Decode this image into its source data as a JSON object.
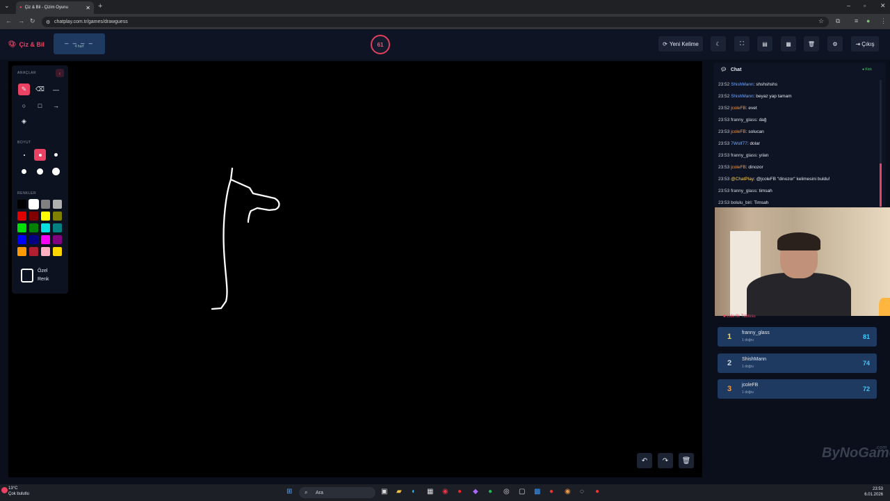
{
  "browser": {
    "tab_title": "Çiz & Bil - Çizim Oyunu",
    "url": "chatplay.com.tr/games/drawguess"
  },
  "header": {
    "logo": "Çiz & Bil",
    "word_mask": "_ _ _ _",
    "word_hint": "4 harf",
    "timer": "61",
    "new_word_label": "Yeni Kelime",
    "exit_label": "Çıkış"
  },
  "tools": {
    "tools_label": "ARAÇLAR",
    "size_label": "BOYUT",
    "colors_label": "RENKLER",
    "custom_color_label": "Özel Renk",
    "colors": [
      "#000000",
      "#ffffff",
      "#808080",
      "#b0b0b0",
      "#e00000",
      "#800000",
      "#ffff00",
      "#808000",
      "#00e000",
      "#008000",
      "#00e0e0",
      "#008080",
      "#0000ff",
      "#000080",
      "#ff00ff",
      "#800080",
      "#ff9900",
      "#b02030",
      "#ffb0c0",
      "#ffd700"
    ]
  },
  "chat": {
    "title": "Chat",
    "status": "Kick",
    "messages": [
      {
        "time": "23:52",
        "user": "ShishMann",
        "text": ": shshshshs",
        "color": "#6fa8ff"
      },
      {
        "time": "23:52",
        "user": "ShishMann",
        "text": ": beyaz yap tamam",
        "color": "#6fa8ff"
      },
      {
        "time": "23:52",
        "user": "jcoleFB",
        "text": ": evet",
        "color": "#ff9a3c"
      },
      {
        "time": "23:53",
        "user": "franny_glass",
        "text": ": dağ",
        "color": "#d8dbe3"
      },
      {
        "time": "23:53",
        "user": "jcoleFB",
        "text": ": solucan",
        "color": "#ff9a3c"
      },
      {
        "time": "23:53",
        "user": "7Wolf77",
        "text": ": dolar",
        "color": "#6fa8ff"
      },
      {
        "time": "23:53",
        "user": "franny_glass",
        "text": ": yılan",
        "color": "#d8dbe3"
      },
      {
        "time": "23:53",
        "user": "jcoleFB",
        "text": ": dinozor",
        "color": "#ff9a3c"
      },
      {
        "time": "23:53",
        "user": "@ChatPlay",
        "text": ": @jcoleFB \"dinozor\" kelimesini buldu!",
        "color": "#ffd34d"
      },
      {
        "time": "23:53",
        "user": "franny_glass",
        "text": ": timsah",
        "color": "#d8dbe3"
      },
      {
        "time": "23:53",
        "user": "bolulu_biri",
        "text": ": Timsah",
        "color": "#d8dbe3"
      }
    ]
  },
  "leaderboard": {
    "title": "Liderlik Tablosu",
    "rows": [
      {
        "rank": "1",
        "name": "franny_glass",
        "sub": "1 doğru",
        "score": "81",
        "rank_color": "#ffd34d"
      },
      {
        "rank": "2",
        "name": "ShishMann",
        "sub": "1 doğru",
        "score": "74",
        "rank_color": "#cfd6e2"
      },
      {
        "rank": "3",
        "name": "jcoleFB",
        "sub": "1 doğru",
        "score": "72",
        "rank_color": "#ff9a3c"
      }
    ]
  },
  "watermark": {
    "main": "ByNoGame",
    "suffix": ".com"
  },
  "taskbar": {
    "weather_temp": "13°C",
    "weather_desc": "Çok bulutlu",
    "search_placeholder": "Ara",
    "time": "23:53",
    "date": "6.01.2026"
  }
}
